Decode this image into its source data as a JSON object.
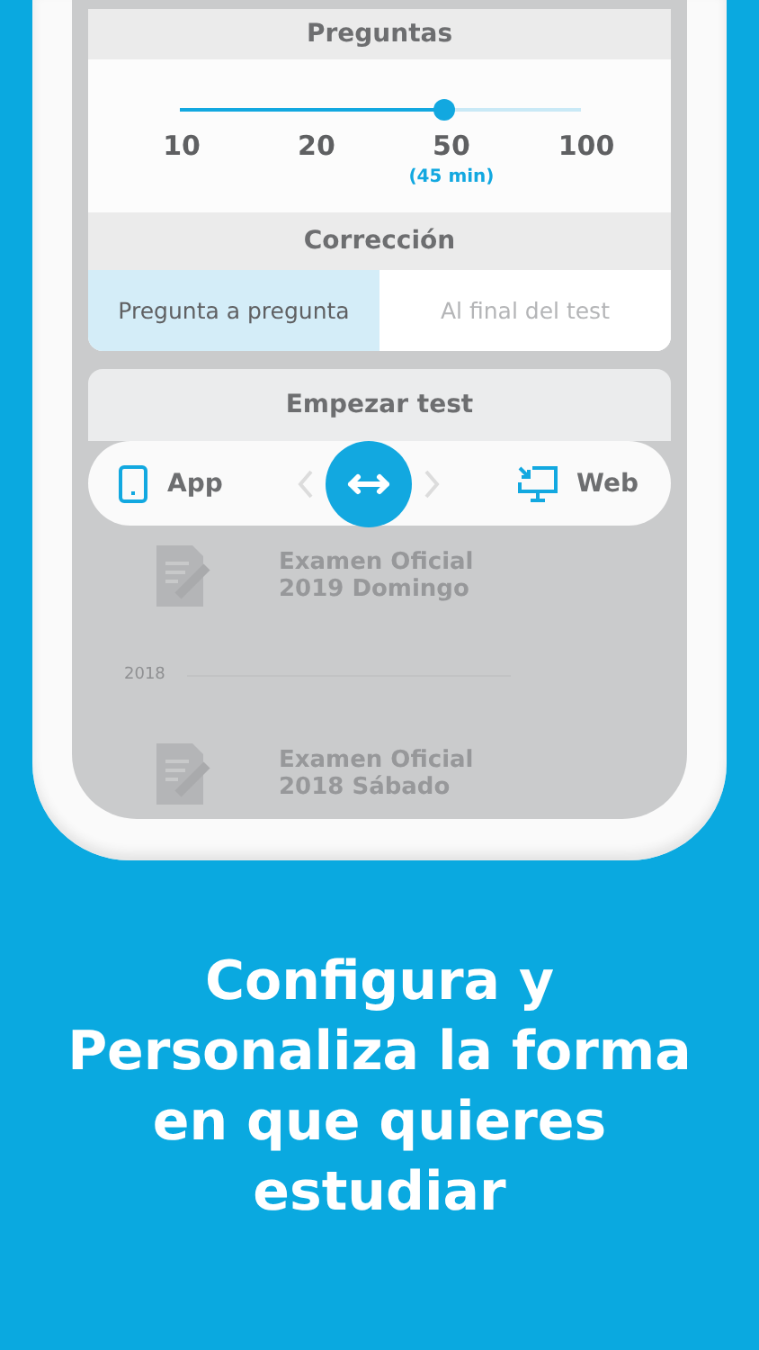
{
  "questions": {
    "title": "Preguntas",
    "level": 0.66,
    "options": [
      {
        "label": "10"
      },
      {
        "label": "20"
      },
      {
        "label": "50",
        "note": "(45 min)"
      },
      {
        "label": "100"
      }
    ]
  },
  "correction": {
    "title": "Corrección",
    "options": [
      {
        "label": "Pregunta a pregunta",
        "selected": true
      },
      {
        "label": "Al final del test",
        "selected": false
      }
    ]
  },
  "start": {
    "title": "Empezar test",
    "left": "App",
    "right": "Web"
  },
  "background_list": [
    {
      "kind": "exam",
      "title": "Examen Oficial",
      "subtitle": "2019 Domingo"
    },
    {
      "kind": "year",
      "title": "2018"
    },
    {
      "kind": "exam",
      "title": "Examen Oficial",
      "subtitle": "2018 Sábado"
    }
  ],
  "caption": "Configura y Personaliza la forma en que quieres estudiar"
}
